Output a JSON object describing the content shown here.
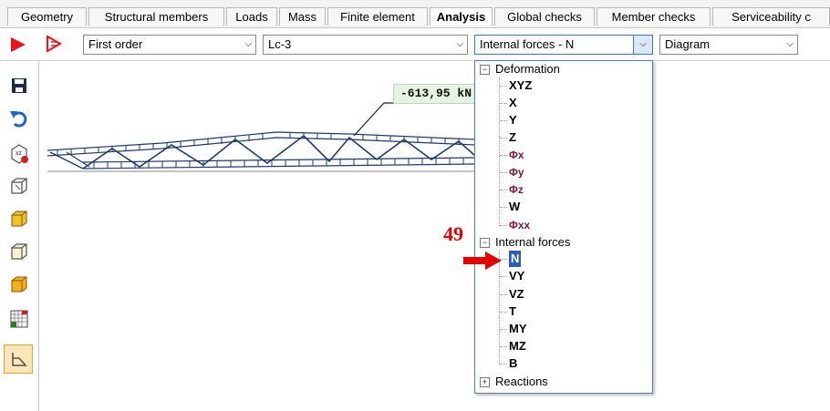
{
  "tabs": [
    {
      "label": "Geometry"
    },
    {
      "label": "Structural members"
    },
    {
      "label": "Loads"
    },
    {
      "label": "Mass"
    },
    {
      "label": "Finite element"
    },
    {
      "label": "Analysis"
    },
    {
      "label": "Global checks"
    },
    {
      "label": "Member checks"
    },
    {
      "label": "Serviceability c"
    }
  ],
  "toolbar": {
    "analysis_type": "First order",
    "load_case": "Lc-3",
    "result_type": "Internal forces - N",
    "display_mode": "Diagram"
  },
  "canvas": {
    "force_label": "-613,95 kN"
  },
  "dropdown": {
    "deformation_label": "Deformation",
    "deformation_items": [
      "XYZ",
      "X",
      "Y",
      "Z",
      "Φx",
      "Φy",
      "Φz",
      "W",
      "Φxx"
    ],
    "internal_forces_label": "Internal forces",
    "internal_forces_items": [
      "N",
      "VY",
      "VZ",
      "T",
      "MY",
      "MZ",
      "B"
    ],
    "reactions_label": "Reactions"
  },
  "annotation": {
    "step_number": "49"
  },
  "colors": {
    "selection": "#2b5fb3",
    "annotation_red": "#e10000",
    "active_tool": "#fde6b8"
  }
}
